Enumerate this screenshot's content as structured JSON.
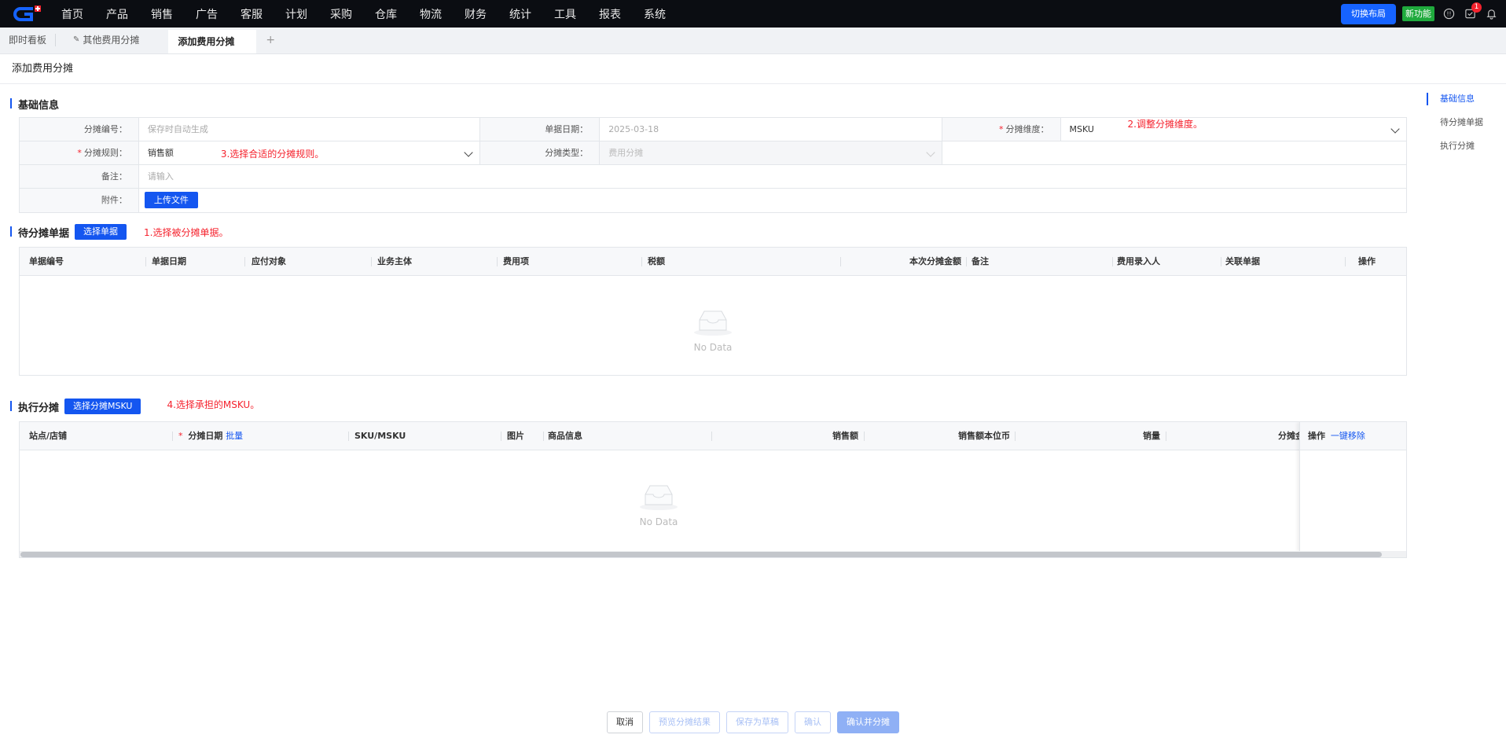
{
  "nav": {
    "menu": [
      "首页",
      "产品",
      "销售",
      "广告",
      "客服",
      "计划",
      "采购",
      "仓库",
      "物流",
      "财务",
      "统计",
      "工具",
      "报表",
      "系统"
    ],
    "switch_layout": "切换布局",
    "new_feature": "新功能",
    "notification_count": "1"
  },
  "tabs": {
    "t1": "即时看板",
    "t2": "其他费用分摊",
    "t3": "添加费用分摊",
    "plus": "+"
  },
  "page_title": "添加费用分摊",
  "basic": {
    "title": "基础信息",
    "code_label": "分摊编号：",
    "code_value": "保存时自动生成",
    "date_label": "单据日期：",
    "date_value": "2025-03-18",
    "dim_label": "分摊维度：",
    "dim_value": "MSKU",
    "dim_note": "2.调整分摊维度。",
    "rule_label": "分摊规则：",
    "rule_value": "销售额",
    "rule_note": "3.选择合适的分摊规则。",
    "type_label": "分摊类型：",
    "type_value": "费用分摊",
    "remark_label": "备注：",
    "remark_placeholder": "请输入",
    "attach_label": "附件：",
    "upload_label": "上传文件"
  },
  "pending": {
    "title": "待分摊单据",
    "select_btn": "选择单据",
    "note": "1.选择被分摊单据。",
    "columns": [
      "单据编号",
      "单据日期",
      "应付对象",
      "业务主体",
      "费用项",
      "税额",
      "本次分摊金额",
      "备注",
      "费用录入人",
      "关联单据",
      "操作"
    ],
    "empty": "No Data"
  },
  "exec": {
    "title": "执行分摊",
    "select_btn": "选择分摊MSKU",
    "note": "4.选择承担的MSKU。",
    "columns": [
      "站点/店铺",
      "分摊日期",
      "SKU/MSKU",
      "图片",
      "商品信息",
      "销售额",
      "销售额本位币",
      "销量",
      "分摊金"
    ],
    "batch": "批量",
    "op": "操作",
    "remove_all": "一键移除",
    "empty": "No Data"
  },
  "anchor": [
    "基础信息",
    "待分摊单据",
    "执行分摊"
  ],
  "footer": {
    "cancel": "取消",
    "preview": "预览分摊结果",
    "draft": "保存为草稿",
    "confirm": "确认",
    "confirm_alloc": "确认并分摊"
  }
}
